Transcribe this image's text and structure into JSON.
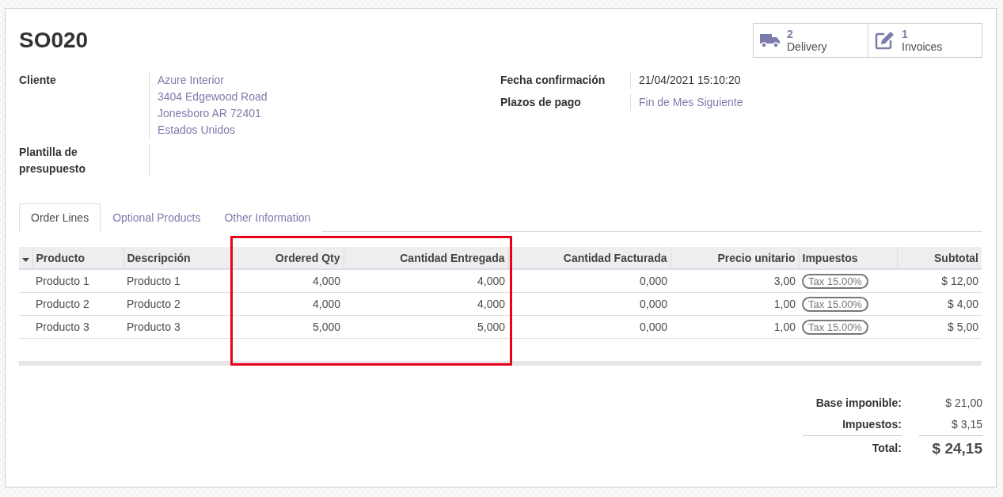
{
  "title": "SO020",
  "stat_buttons": [
    {
      "kind": "truck",
      "count": "2",
      "label": "Delivery"
    },
    {
      "kind": "edit",
      "count": "1",
      "label": "Invoices"
    }
  ],
  "fields_left": [
    {
      "label": "Cliente",
      "lines": [
        "Azure Interior",
        "3404 Edgewood Road",
        "Jonesboro AR 72401",
        "Estados Unidos"
      ]
    },
    {
      "label": "Plantilla de presupuesto"
    }
  ],
  "fields_right": [
    {
      "label": "Fecha confirmación",
      "value": "21/04/2021 15:10:20",
      "link": false
    },
    {
      "label": "Plazos de pago",
      "value": "Fin de Mes Siguiente",
      "link": true
    }
  ],
  "tabs": [
    {
      "label": "Order Lines",
      "selected": true
    },
    {
      "label": "Optional Products",
      "selected": false
    },
    {
      "label": "Other Information",
      "selected": false
    }
  ],
  "table": {
    "columns": [
      {
        "label": "Producto",
        "highlighted": false
      },
      {
        "label": "Descripción",
        "highlighted": false
      },
      {
        "label": "Ordered Qty",
        "highlighted": true
      },
      {
        "label": "Cantidad Entregada",
        "highlighted": true
      },
      {
        "label": "Cantidad Facturada",
        "highlighted": false
      },
      {
        "label": "Precio unitario",
        "highlighted": false
      },
      {
        "label": "Impuestos",
        "highlighted": false
      },
      {
        "label": "Subtotal",
        "highlighted": false
      }
    ],
    "rows": [
      [
        "Producto 1",
        "Producto 1",
        "4,000",
        "4,000",
        "0,000",
        "3,00",
        "Tax 15.00%",
        "$ 12,00"
      ],
      [
        "Producto 2",
        "Producto 2",
        "4,000",
        "4,000",
        "0,000",
        "1,00",
        "Tax 15.00%",
        "$ 4,00"
      ],
      [
        "Producto 3",
        "Producto 3",
        "5,000",
        "5,000",
        "0,000",
        "1,00",
        "Tax 15.00%",
        "$ 5,00"
      ]
    ]
  },
  "totals": [
    {
      "label": "Base imponible:",
      "value": "$ 21,00",
      "grand": false
    },
    {
      "label": "Impuestos:",
      "value": "$ 3,15",
      "grand": false
    },
    {
      "label": "Total:",
      "value": "$ 24,15",
      "grand": true
    }
  ]
}
